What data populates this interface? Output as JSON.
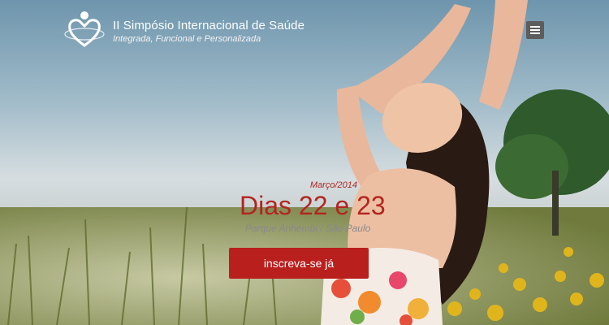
{
  "brand": {
    "title": "II Simpósio Internacional de Saúde",
    "subtitle": "Integrada, Funcional e Personalizada"
  },
  "event": {
    "month": "Março/2014",
    "dates": "Dias 22 e 23",
    "location": "Parque Anhembi / São Paulo"
  },
  "cta": {
    "label": "inscreva-se já"
  },
  "colors": {
    "accent": "#b91f1d",
    "menu": "#5d5d5d",
    "muted": "#8a8a8a"
  },
  "icons": {
    "logo": "heart-figure-logo-icon",
    "menu": "hamburger-menu-icon"
  }
}
